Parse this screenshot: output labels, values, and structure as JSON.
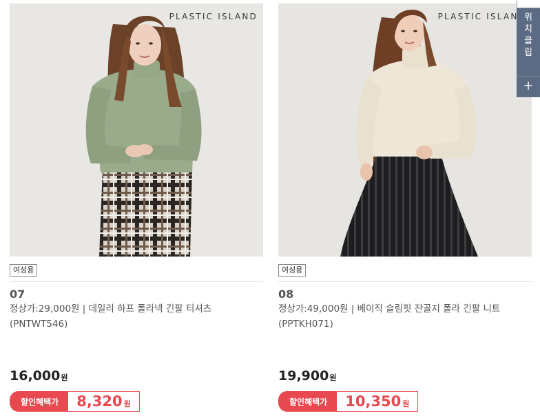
{
  "products": [
    {
      "brand": "PLASTIC ISLAND",
      "tag": "여성용",
      "number": "07",
      "description": "정상가:29,000원 | 데일리 하프 폴라넥 긴팔 티셔츠 (PNTWT546)",
      "price": "16,000",
      "price_unit": "원",
      "discount_label": "할인혜택가",
      "discount_price": "8,320",
      "discount_unit": "원"
    },
    {
      "brand": "PLASTIC ISLAND",
      "tag": "여성용",
      "number": "08",
      "description": "정상가:49,000원 | 베이직 슬림핏 잔골지 폴라 긴팔 니트 (PPTKH071)",
      "price": "19,900",
      "price_unit": "원",
      "discount_label": "할인혜택가",
      "discount_price": "10,350",
      "discount_unit": "원"
    }
  ],
  "side_widget": {
    "label": "위치클립",
    "plus": "+"
  },
  "colors": {
    "accent": "#e8484f",
    "side": "#5c6b84"
  }
}
